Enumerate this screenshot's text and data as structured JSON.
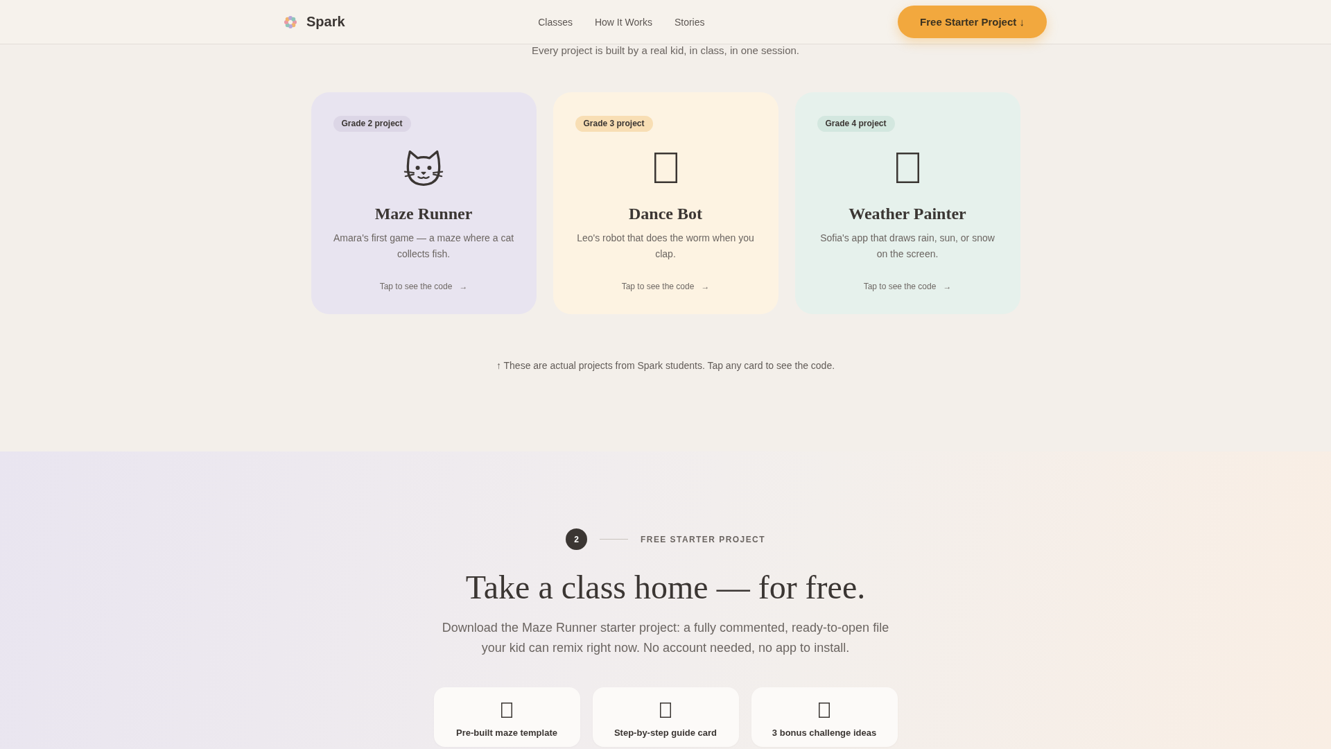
{
  "header": {
    "logo_text": "Spark",
    "nav": [
      {
        "label": "Classes"
      },
      {
        "label": "How It Works"
      },
      {
        "label": "Stories"
      }
    ],
    "cta": "Free Starter Project ↓"
  },
  "projects_section": {
    "subtitle": "Every project is built by a real kid, in class, in one session.",
    "cards": [
      {
        "badge": {
          "label": "Grade 2 project",
          "color": "#dcd6e6"
        },
        "color": "#e8e4f0",
        "title": "Maze Runner",
        "description": "Amara's first game — a maze where a cat collects fish.",
        "link": "Tap to see the code",
        "link_arrow": "→"
      },
      {
        "badge": {
          "label": "Grade 3 project",
          "color": "#f8deb4"
        },
        "color": "#fdf3e2",
        "title": "Dance Bot",
        "description": "Leo's robot that does the worm when you clap.",
        "link": "Tap to see the code",
        "link_arrow": "→"
      },
      {
        "badge": {
          "label": "Grade 4 project",
          "color": "#d3e7df"
        },
        "color": "#e6f1ec",
        "title": "Weather Painter",
        "description": "Sofia's app that draws rain, sun, or snow on the screen.",
        "link": "Tap to see the code",
        "link_arrow": "→"
      }
    ],
    "note": "↑ These are actual projects from Spark students. Tap any card to see the code."
  },
  "starter_section": {
    "step": "2",
    "eyebrow": "FREE STARTER PROJECT",
    "heading": "Take a class home — for free.",
    "description": "Download the Maze Runner starter project: a fully commented, ready-to-open file your kid can remix right now. No account needed, no app to install.",
    "features": [
      {
        "label": "Pre-built maze template"
      },
      {
        "label": "Step-by-step guide card"
      },
      {
        "label": "3 bonus challenge ideas"
      }
    ]
  }
}
